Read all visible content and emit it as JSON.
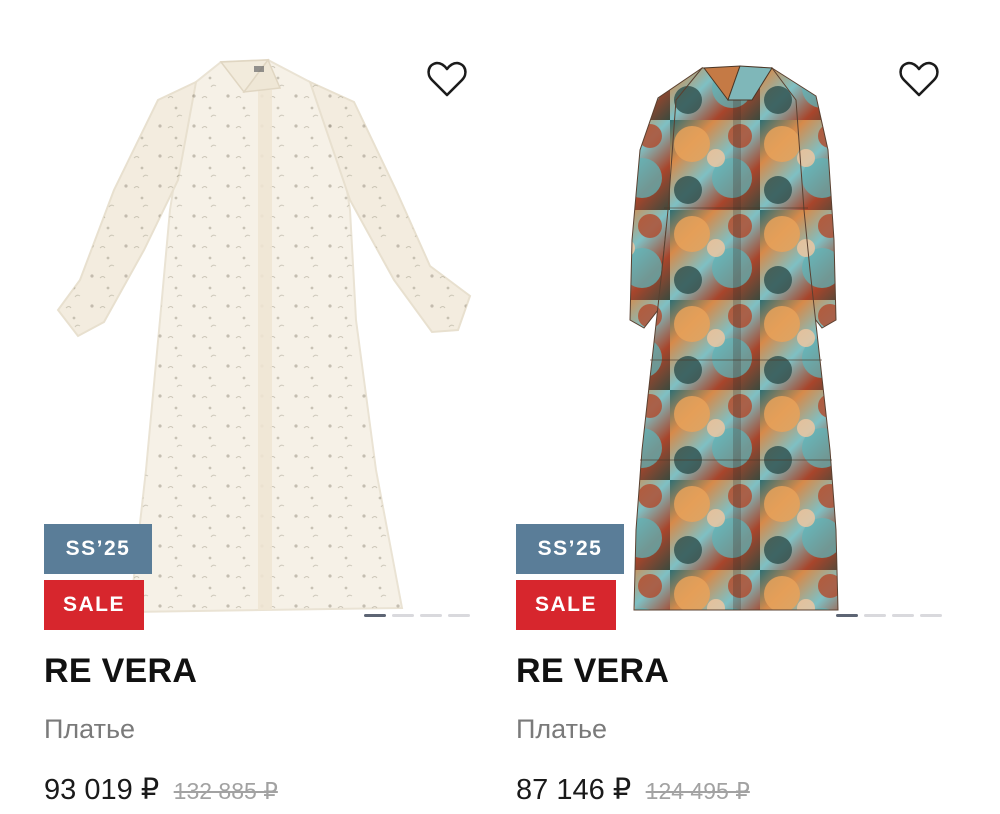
{
  "products": [
    {
      "image_description_icon": "white-shirt-dress-image",
      "season_badge": "SS’25",
      "sale_badge": "SALE",
      "brand": "RE VERA",
      "type": "Платье",
      "price": "93 019 ₽",
      "old_price": "132 885 ₽",
      "carousel_pages": 4,
      "carousel_active": 1
    },
    {
      "image_description_icon": "floral-tiered-dress-image",
      "season_badge": "SS’25",
      "sale_badge": "SALE",
      "brand": "RE VERA",
      "type": "Платье",
      "price": "87 146 ₽",
      "old_price": "124 495 ₽",
      "carousel_pages": 4,
      "carousel_active": 1
    }
  ],
  "colors": {
    "season_badge": "#5a7d98",
    "sale_badge": "#d7262d",
    "price": "#1a1a1a",
    "old_price": "#a2a2a2"
  },
  "icons": {
    "favorite": "heart-outline-icon"
  }
}
